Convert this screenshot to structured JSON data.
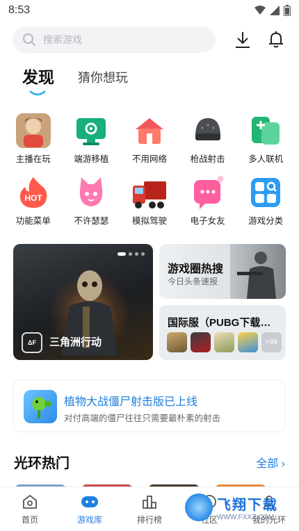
{
  "status_bar": {
    "time": "8:53"
  },
  "search": {
    "placeholder": "搜索游戏"
  },
  "tabs": [
    {
      "label": "发现",
      "active": true
    },
    {
      "label": "猜你想玩",
      "active": false
    }
  ],
  "categories": [
    {
      "label": "主播在玩",
      "icon": "streamer-avatar-icon"
    },
    {
      "label": "端游移植",
      "icon": "monitor-controller-icon"
    },
    {
      "label": "不用网络",
      "icon": "house-icon"
    },
    {
      "label": "枪战射击",
      "icon": "helmet-icon"
    },
    {
      "label": "多人联机",
      "icon": "multiplayer-icon"
    },
    {
      "label": "功能菜单",
      "icon": "hot-flame-icon"
    },
    {
      "label": "不许瑟瑟",
      "icon": "pink-cat-icon"
    },
    {
      "label": "模拟驾驶",
      "icon": "truck-icon"
    },
    {
      "label": "电子女友",
      "icon": "heart-chat-icon"
    },
    {
      "label": "游戏分类",
      "icon": "category-grid-icon"
    }
  ],
  "banner": {
    "title": "三角洲行动",
    "avatar_text": "ΔF"
  },
  "hot_card": {
    "title": "游戏圈热搜",
    "subtitle": "今日头条速报"
  },
  "intl_card": {
    "title": "国际服（PUBG下载…",
    "more_badge": "+99"
  },
  "promo": {
    "title": "植物大战僵尸射击版已上线",
    "description": "对付高端的僵尸往往只需要最朴素的射击"
  },
  "section": {
    "title": "光环热门",
    "more": "全部"
  },
  "bottom_nav": [
    {
      "label": "首页",
      "icon": "home-icon",
      "active": false
    },
    {
      "label": "游戏库",
      "icon": "gamepad-icon",
      "active": true
    },
    {
      "label": "排行榜",
      "icon": "ranking-icon",
      "active": false
    },
    {
      "label": "社区",
      "icon": "community-icon",
      "active": false
    },
    {
      "label": "我的光环",
      "icon": "profile-icon",
      "active": false
    }
  ],
  "watermark": {
    "main": "飞翔下载",
    "url": "WWW.FXXZ.COM"
  },
  "colors": {
    "accent": "#1f7fe0",
    "search_bg": "#f2f3f5"
  }
}
